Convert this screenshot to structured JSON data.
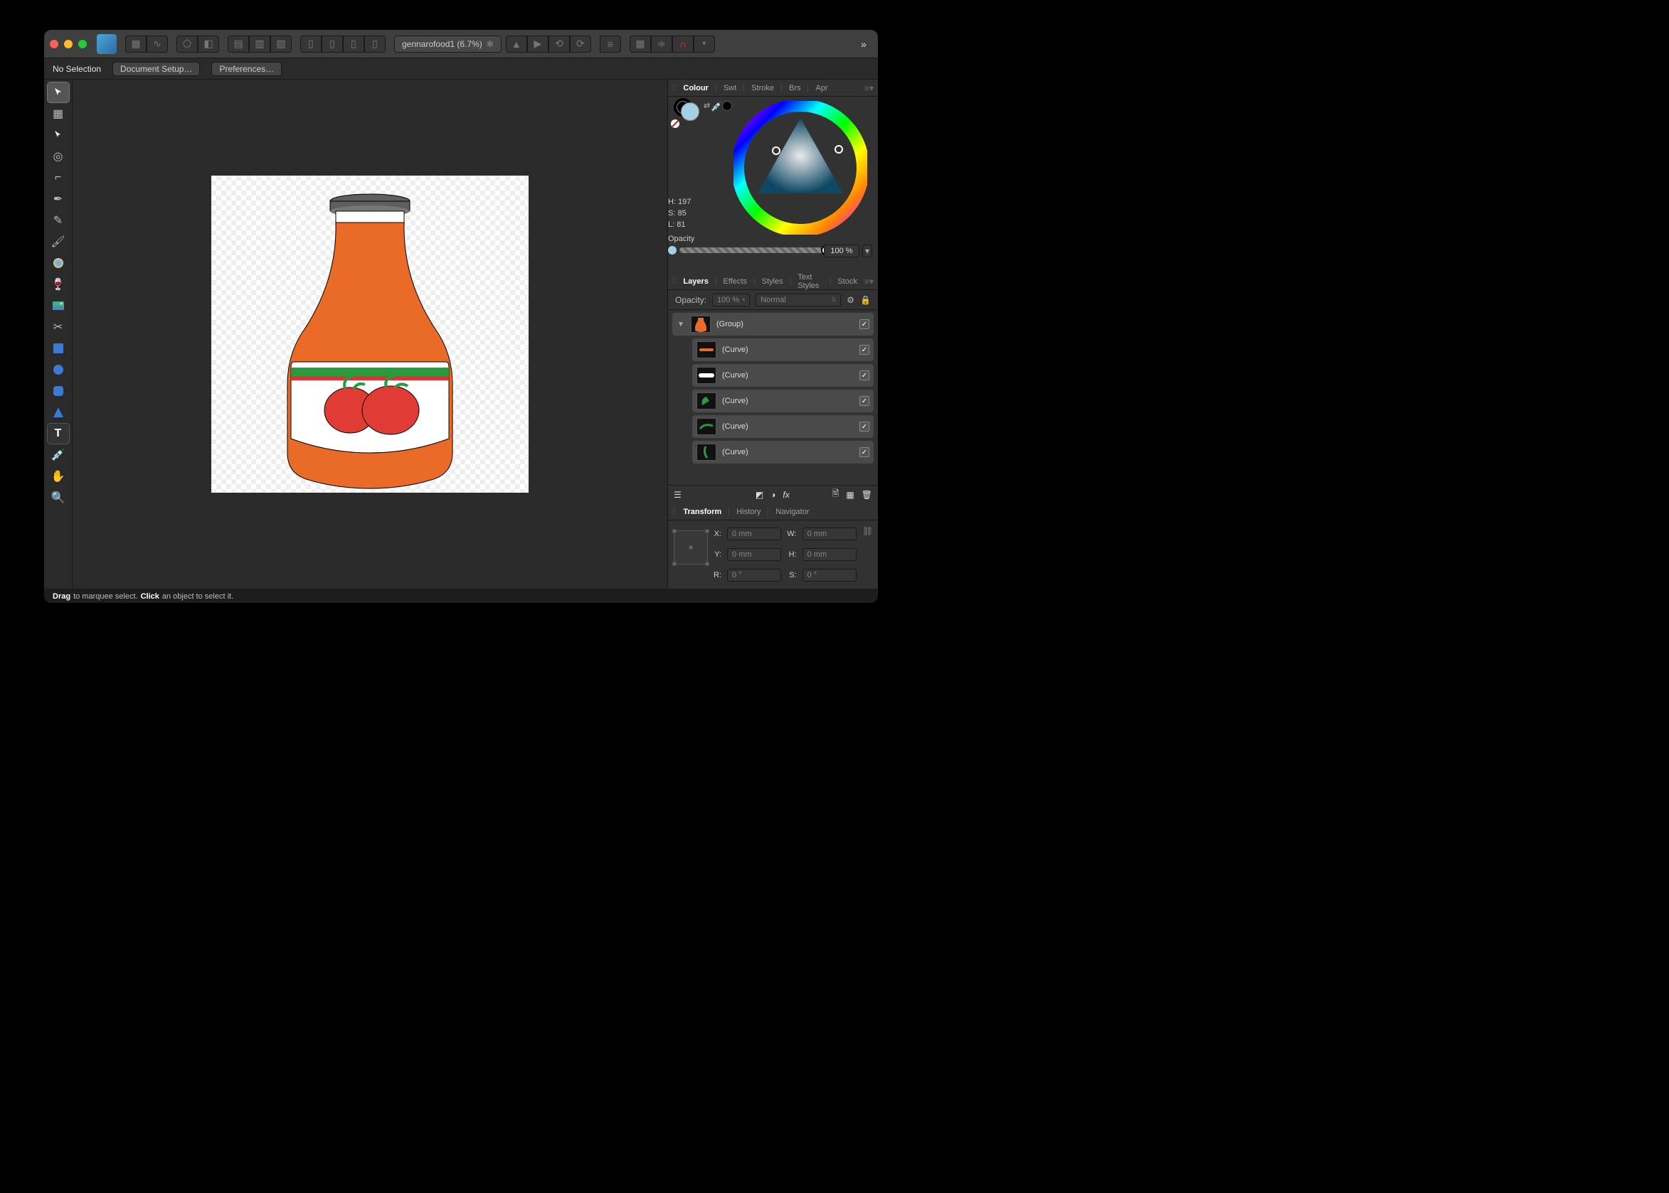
{
  "doc": {
    "title": "gennarofood1 (6.7%)",
    "dirty": "✻"
  },
  "ctx": {
    "selection": "No Selection",
    "docSetup": "Document Setup…",
    "prefs": "Preferences…"
  },
  "colour": {
    "tabs": [
      "Colour",
      "Swt",
      "Stroke",
      "Brs",
      "Apr"
    ],
    "h": "H: 197",
    "s": "S: 85",
    "l": "L: 81",
    "opLabel": "Opacity",
    "opValue": "100 %"
  },
  "layers": {
    "tabs": [
      "Layers",
      "Effects",
      "Styles",
      "Text Styles",
      "Stock"
    ],
    "opacityLabel": "Opacity:",
    "opacityValue": "100 %",
    "blendMode": "Normal",
    "items": [
      {
        "name": "(Group)",
        "indent": 0,
        "disclosure": "▼"
      },
      {
        "name": "(Curve)",
        "indent": 1,
        "thumbColor": "#e26a2b"
      },
      {
        "name": "(Curve)",
        "indent": 1,
        "thumbColor": "#ffffff"
      },
      {
        "name": "(Curve)",
        "indent": 1,
        "thumbColor": "#2a9a3f"
      },
      {
        "name": "(Curve)",
        "indent": 1,
        "thumbColor": "#2a9a3f"
      },
      {
        "name": "(Curve)",
        "indent": 1,
        "thumbColor": "#2a9a3f"
      }
    ]
  },
  "xform": {
    "tabs": [
      "Transform",
      "History",
      "Navigator"
    ],
    "X": "X:",
    "Y": "Y:",
    "W": "W:",
    "H": "H:",
    "R": "R:",
    "S": "S:",
    "xv": "0 mm",
    "yv": "0 mm",
    "wv": "0 mm",
    "hv": "0 mm",
    "rv": "0 °",
    "sv": "0 °"
  },
  "status": {
    "drag": "Drag",
    "dragTxt": " to marquee select. ",
    "click": "Click",
    "clickTxt": " an object to select it."
  }
}
